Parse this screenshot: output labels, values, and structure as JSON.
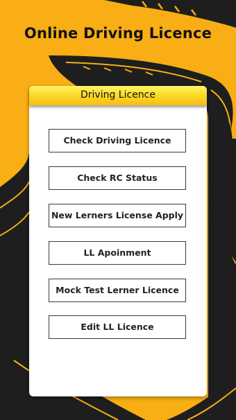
{
  "header": {
    "title": "Online Driving Licence"
  },
  "card": {
    "title": "Driving Licence",
    "buttons": [
      "Check Driving Licence",
      "Check RC Status",
      "New Lerners License Apply",
      "LL Apoinment",
      "Mock Test Lerner Licence",
      "Edit LL Licence"
    ]
  },
  "colors": {
    "background": "#F8AE14",
    "road": "#1E1E1E",
    "header_bar": "#FBDB2A",
    "card": "#FFFFFF"
  }
}
